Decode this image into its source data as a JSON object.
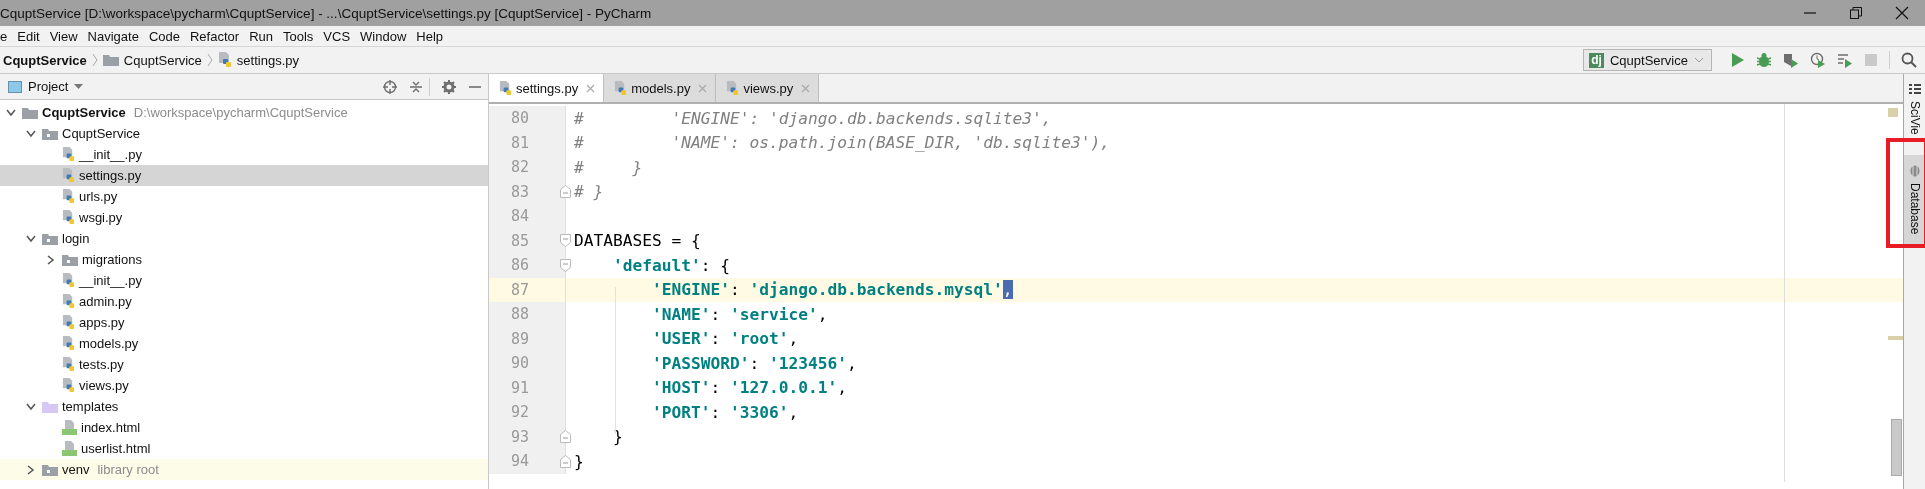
{
  "window": {
    "title": "CquptService [D:\\workspace\\pycharm\\CquptService] - ...\\CquptService\\settings.py [CquptService] - PyCharm"
  },
  "menu": [
    {
      "label": "e"
    },
    {
      "label": "Edit"
    },
    {
      "label": "View"
    },
    {
      "label": "Navigate"
    },
    {
      "label": "Code"
    },
    {
      "label": "Refactor"
    },
    {
      "label": "Run"
    },
    {
      "label": "Tools"
    },
    {
      "label": "VCS"
    },
    {
      "label": "Window"
    },
    {
      "label": "Help"
    }
  ],
  "breadcrumbs": [
    {
      "label": "CquptService",
      "kind": "project"
    },
    {
      "label": "CquptService",
      "kind": "folder"
    },
    {
      "label": "settings.py",
      "kind": "py"
    }
  ],
  "run_config": {
    "logo": "dj",
    "label": "CquptService"
  },
  "project_panel": {
    "title": "Project",
    "tree": [
      {
        "label": "CquptService",
        "kind": "project",
        "note": "D:\\workspace\\pycharm\\CquptService",
        "expanded": true,
        "selected": false,
        "children": [
          {
            "label": "CquptService",
            "kind": "folder",
            "expanded": true,
            "selected": false,
            "children": [
              {
                "label": "__init__.py",
                "kind": "py",
                "selected": false
              },
              {
                "label": "settings.py",
                "kind": "py",
                "selected": true
              },
              {
                "label": "urls.py",
                "kind": "py",
                "selected": false
              },
              {
                "label": "wsgi.py",
                "kind": "py",
                "selected": false
              }
            ]
          },
          {
            "label": "login",
            "kind": "folder",
            "expanded": true,
            "selected": false,
            "children": [
              {
                "label": "migrations",
                "kind": "folder",
                "expanded": false,
                "selected": false
              },
              {
                "label": "__init__.py",
                "kind": "py",
                "selected": false
              },
              {
                "label": "admin.py",
                "kind": "py",
                "selected": false
              },
              {
                "label": "apps.py",
                "kind": "py",
                "selected": false
              },
              {
                "label": "models.py",
                "kind": "py",
                "selected": false
              },
              {
                "label": "tests.py",
                "kind": "py",
                "selected": false
              },
              {
                "label": "views.py",
                "kind": "py",
                "selected": false
              }
            ]
          },
          {
            "label": "templates",
            "kind": "templates",
            "expanded": true,
            "selected": false,
            "children": [
              {
                "label": "index.html",
                "kind": "html",
                "selected": false
              },
              {
                "label": "userlist.html",
                "kind": "html",
                "selected": false
              }
            ]
          },
          {
            "label": "venv",
            "kind": "library",
            "note": "library root",
            "expanded": false,
            "selected": false
          }
        ]
      }
    ]
  },
  "editor": {
    "tabs": [
      {
        "label": "settings.py",
        "selected": true
      },
      {
        "label": "models.py",
        "selected": false
      },
      {
        "label": "views.py",
        "selected": false
      }
    ],
    "lines": [
      {
        "number": "80",
        "current": false,
        "kind": "plain",
        "tokens": [
          {
            "text": "#         'ENGINE': 'django.db.backends.sqlite3',",
            "kind": "comment"
          }
        ]
      },
      {
        "number": "81",
        "current": false,
        "kind": "plain",
        "tokens": [
          {
            "text": "#         'NAME': os.path.join(BASE_DIR, 'db.sqlite3'),",
            "kind": "comment"
          }
        ]
      },
      {
        "number": "82",
        "current": false,
        "kind": "plain",
        "tokens": [
          {
            "text": "#     }",
            "kind": "comment"
          }
        ]
      },
      {
        "number": "83",
        "current": false,
        "kind": "fold_end",
        "tokens": [
          {
            "text": "# }",
            "kind": "comment"
          }
        ]
      },
      {
        "number": "84",
        "current": false,
        "kind": "plain"
      },
      {
        "number": "85",
        "current": false,
        "kind": "fold_start",
        "tokens": [
          {
            "text": "DATABASES = {",
            "kind": "plain"
          }
        ]
      },
      {
        "number": "86",
        "current": false,
        "kind": "fold_start",
        "tokens": [
          {
            "text": "    'default'",
            "kind": "string"
          },
          {
            "text": ": {",
            "kind": "plain"
          }
        ]
      },
      {
        "number": "87",
        "current": true,
        "kind": "plain",
        "tokens": [
          {
            "text": "        'ENGINE'",
            "kind": "string"
          },
          {
            "text": ": ",
            "kind": "plain"
          },
          {
            "text": "'django.db.backends.mysql'",
            "kind": "string"
          },
          {
            "text": ",",
            "kind": "caret"
          }
        ]
      },
      {
        "number": "88",
        "current": false,
        "kind": "plain",
        "tokens": [
          {
            "text": "        'NAME'",
            "kind": "string"
          },
          {
            "text": ": ",
            "kind": "plain"
          },
          {
            "text": "'service'",
            "kind": "string"
          },
          {
            "text": ",",
            "kind": "plain"
          }
        ]
      },
      {
        "number": "89",
        "current": false,
        "kind": "plain",
        "tokens": [
          {
            "text": "        'USER'",
            "kind": "string"
          },
          {
            "text": ": ",
            "kind": "plain"
          },
          {
            "text": "'root'",
            "kind": "string"
          },
          {
            "text": ",",
            "kind": "plain"
          }
        ]
      },
      {
        "number": "90",
        "current": false,
        "kind": "plain",
        "tokens": [
          {
            "text": "        'PASSWORD'",
            "kind": "string"
          },
          {
            "text": ": ",
            "kind": "plain"
          },
          {
            "text": "'123456'",
            "kind": "string"
          },
          {
            "text": ",",
            "kind": "plain"
          }
        ]
      },
      {
        "number": "91",
        "current": false,
        "kind": "plain",
        "tokens": [
          {
            "text": "        'HOST'",
            "kind": "string"
          },
          {
            "text": ": ",
            "kind": "plain"
          },
          {
            "text": "'127.0.0.1'",
            "kind": "string"
          },
          {
            "text": ",",
            "kind": "plain"
          }
        ]
      },
      {
        "number": "92",
        "current": false,
        "kind": "plain",
        "tokens": [
          {
            "text": "        'PORT'",
            "kind": "string"
          },
          {
            "text": ": ",
            "kind": "plain"
          },
          {
            "text": "'3306'",
            "kind": "string"
          },
          {
            "text": ",",
            "kind": "plain"
          }
        ]
      },
      {
        "number": "93",
        "current": false,
        "kind": "fold_end",
        "tokens": [
          {
            "text": "    }",
            "kind": "plain"
          }
        ]
      },
      {
        "number": "94",
        "current": false,
        "kind": "fold_end",
        "tokens": [
          {
            "text": "}",
            "kind": "plain"
          }
        ]
      }
    ]
  },
  "side_tabs": [
    {
      "label": "SciVie",
      "selected": false
    },
    {
      "label": "Database",
      "selected": true
    }
  ]
}
